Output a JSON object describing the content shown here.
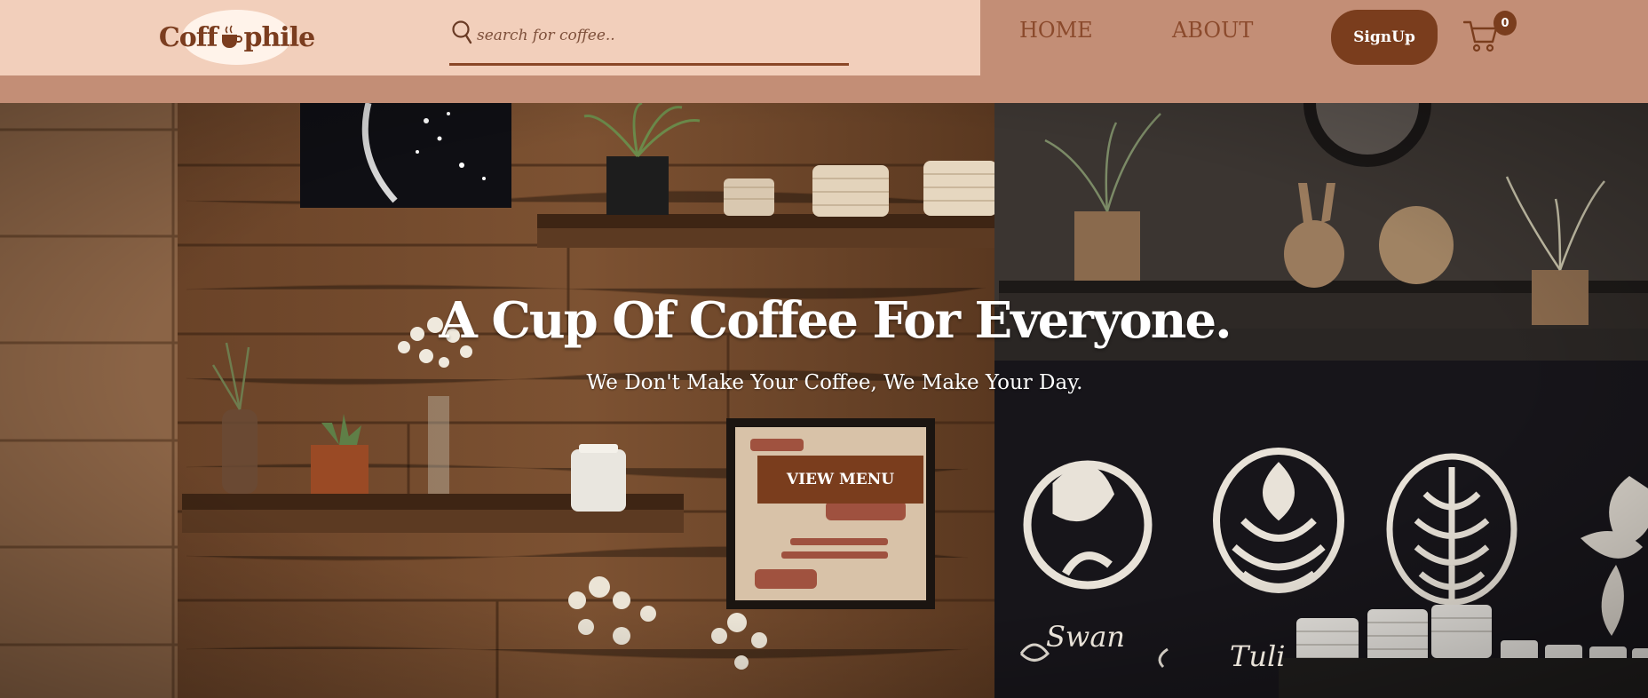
{
  "logo": {
    "text_left": "Coff",
    "text_right": "phile",
    "icon": "coffee-cup-icon"
  },
  "search": {
    "placeholder": "search for coffee..",
    "icon": "search-icon"
  },
  "nav": {
    "home": "HOME",
    "about": "ABOUT"
  },
  "signup": {
    "label": "SignUp"
  },
  "cart": {
    "count": "0",
    "icon": "cart-icon"
  },
  "hero": {
    "title": "A Cup Of Coffee For Everyone.",
    "subtitle": "We Don't Make Your Coffee, We Make Your Day.",
    "cta": "VIEW MENU",
    "latte_labels": [
      "Swan",
      "Tuli"
    ]
  },
  "colors": {
    "brand": "#7a3d1d",
    "header_bg": "#c38e76",
    "header_light": "#f2cfbb",
    "nav_text": "#8b4a2c"
  }
}
